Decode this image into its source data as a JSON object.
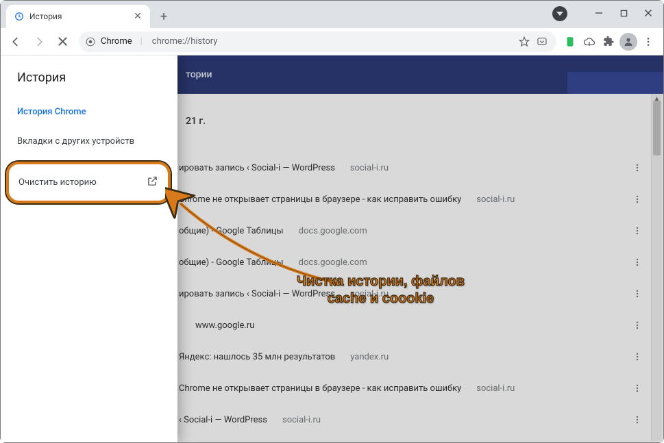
{
  "tab": {
    "title": "История"
  },
  "omnibox": {
    "label": "Chrome",
    "path": "chrome://history"
  },
  "bluebar_hint": "тории",
  "sidebar": {
    "title": "История",
    "chrome_history": "История Chrome",
    "other_tabs": "Вкладки с других устройств",
    "clear": "Очистить историю"
  },
  "date": "21 г.",
  "rows": [
    {
      "title": "ировать запись ‹ Social-i — WordPress",
      "domain": "social-i.ru",
      "indent": false
    },
    {
      "title": "Chrome не открывает страницы в браузере - как исправить ошибку",
      "domain": "social-i.ru",
      "indent": false
    },
    {
      "title": "общие) - Google Таблицы",
      "domain": "docs.google.com",
      "indent": false
    },
    {
      "title": "общие) - Google Таблицы",
      "domain": "docs.google.com",
      "indent": false
    },
    {
      "title": "ировать запись ‹ Social-i — WordPress",
      "domain": "social-i.ru",
      "indent": false
    },
    {
      "title": "www.google.ru",
      "domain": "",
      "indent": true
    },
    {
      "title": "Яндекс: нашлось 35 млн результатов",
      "domain": "yandex.ru",
      "indent": false
    },
    {
      "title": "Chrome не открывает страницы в браузере - как исправить ошибку",
      "domain": "social-i.ru",
      "indent": false
    },
    {
      "title": "‹ Social-i — WordPress",
      "domain": "social-i.ru",
      "indent": false
    }
  ],
  "annotation": {
    "line1": "Чистка истории, файлов",
    "line2": "cache и coookie"
  }
}
